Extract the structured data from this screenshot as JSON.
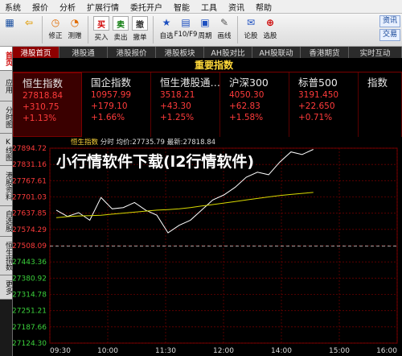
{
  "menu": [
    "系统",
    "报价",
    "分析",
    "扩展行情",
    "委托开户",
    "智能",
    "工具",
    "资讯",
    "帮助"
  ],
  "toolbar": {
    "buttons": [
      {
        "label": "",
        "icon": "grid-icon"
      },
      {
        "label": "",
        "icon": "back-arrow-icon"
      },
      {
        "label": "修正",
        "icon": "clock-icon"
      },
      {
        "label": "测赠",
        "icon": "clock2-icon"
      },
      {
        "label": "买入",
        "icon": "buy-icon",
        "glyph": "买"
      },
      {
        "label": "卖出",
        "icon": "sell-icon",
        "glyph": "卖"
      },
      {
        "label": "撤单",
        "icon": "cancel-icon",
        "glyph": "撤"
      },
      {
        "label": "自选",
        "icon": "star-icon"
      },
      {
        "label": "F10/F9",
        "icon": "f10-icon"
      },
      {
        "label": "周期",
        "icon": "calendar-icon"
      },
      {
        "label": "画线",
        "icon": "pen-icon"
      },
      {
        "label": "论股",
        "icon": "chat-icon"
      },
      {
        "label": "选股",
        "icon": "filter-icon"
      }
    ],
    "right_buttons": [
      "资讯",
      "交易"
    ]
  },
  "sidebar": [
    "首页",
    "应用",
    "分时图",
    "K线图",
    "港股资料",
    "自选股",
    "恒生指数",
    "更多"
  ],
  "tabs": [
    "港股首页",
    "港股通",
    "港股报价",
    "港股板块",
    "AH股对比",
    "AH股联动",
    "香港期货",
    "实时互动"
  ],
  "panel_title": "重要指数",
  "cards": [
    {
      "name": "恒生指数",
      "value": "27818.84",
      "change": "+310.75",
      "pct": "+1.13%"
    },
    {
      "name": "国企指数",
      "value": "10957.99",
      "change": "+179.10",
      "pct": "+1.66%"
    },
    {
      "name": "恒生港股通…",
      "value": "3518.21",
      "change": "+43.30",
      "pct": "+1.25%"
    },
    {
      "name": "沪深300",
      "value": "4050.30",
      "change": "+62.83",
      "pct": "+1.58%"
    },
    {
      "name": "标普500",
      "value": "3191.450",
      "change": "+22.650",
      "pct": "+0.71%"
    },
    {
      "name": "指数",
      "value": "",
      "change": "",
      "pct": ""
    }
  ],
  "legend": {
    "name": "恒生指数",
    "period": "分时",
    "avg_label": "均价:",
    "avg": "27735.79",
    "last_label": "最新:",
    "last": "27818.84"
  },
  "overlay_text": "小行情软件下载(l2行情软件)",
  "chart_data": {
    "type": "line",
    "yticks": [
      "27894.72",
      "27831.16",
      "27767.61",
      "27701.03",
      "27637.85",
      "27574.29",
      "27508.09",
      "27443.36",
      "27380.92",
      "27314.78",
      "27251.21",
      "27187.66",
      "27124.30"
    ],
    "xticks": [
      "09:30",
      "10:00",
      "11:30",
      "12:00",
      "14:00",
      "15:00",
      "16:00"
    ],
    "ylim": [
      27124.3,
      27894.72
    ],
    "series": [
      {
        "name": "",
        "color": "#ffffff",
        "values": [
          27650,
          27625,
          27640,
          27610,
          27700,
          27655,
          27660,
          27680,
          27650,
          27630,
          27560,
          27590,
          27610,
          27650,
          27690,
          27710,
          27740,
          27780,
          27800,
          27790,
          27840,
          27880,
          27870,
          27890
        ]
      },
      {
        "name": "",
        "color": "#d8d800",
        "values": [
          27620,
          27624,
          27627,
          27628,
          27630,
          27634,
          27638,
          27642,
          27646,
          27650,
          27652,
          27655,
          27660,
          27666,
          27672,
          27678,
          27684,
          27690,
          27696,
          27702,
          27708,
          27712,
          27716,
          27720
        ]
      }
    ],
    "preclose": 27508.09
  }
}
